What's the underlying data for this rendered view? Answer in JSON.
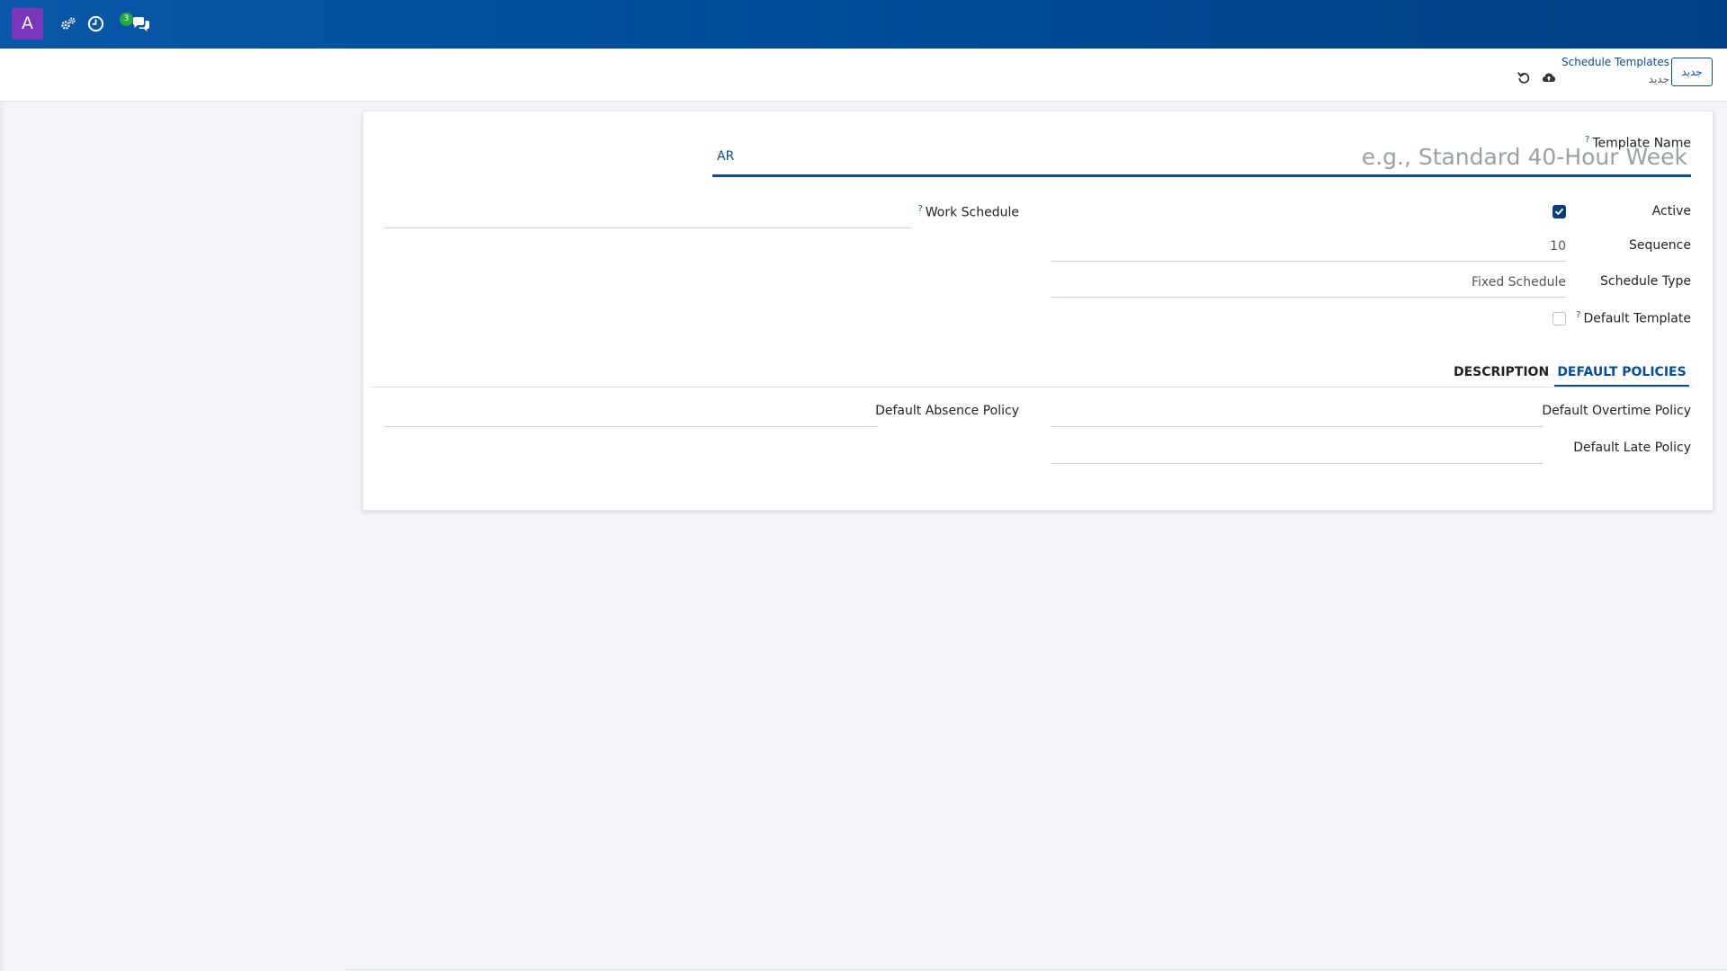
{
  "navbar": {
    "avatar_letter": "A",
    "badge_count": "3",
    "icons": [
      "gears-icon",
      "clock-icon",
      "chat-icon"
    ],
    "background_color": "#0a56a8",
    "avatar_color": "#7a36b8"
  },
  "control_panel": {
    "new_button_label": "جديد",
    "breadcrumb_parent": "Schedule Templates",
    "breadcrumb_current": "جديد"
  },
  "form": {
    "template_name": {
      "label": "Template Name",
      "help": "?",
      "placeholder": "e.g., Standard 40-Hour Week",
      "lang": "AR"
    },
    "work_schedule": {
      "label": "Work Schedule",
      "help": "?",
      "value": ""
    },
    "active": {
      "label": "Active",
      "checked": true
    },
    "sequence": {
      "label": "Sequence",
      "value": "10"
    },
    "schedule_type": {
      "label": "Schedule Type",
      "value": "Fixed Schedule"
    },
    "default_template": {
      "label": "Default Template",
      "help": "?",
      "checked": false
    },
    "tabs": [
      {
        "label": "DEFAULT POLICIES",
        "active": true
      },
      {
        "label": "DESCRIPTION",
        "active": false
      }
    ],
    "policies": {
      "overtime_label": "Default Overtime Policy",
      "late_label": "Default Late Policy",
      "absence_label": "Default Absence Policy"
    },
    "accent_color": "#0a4d94"
  }
}
